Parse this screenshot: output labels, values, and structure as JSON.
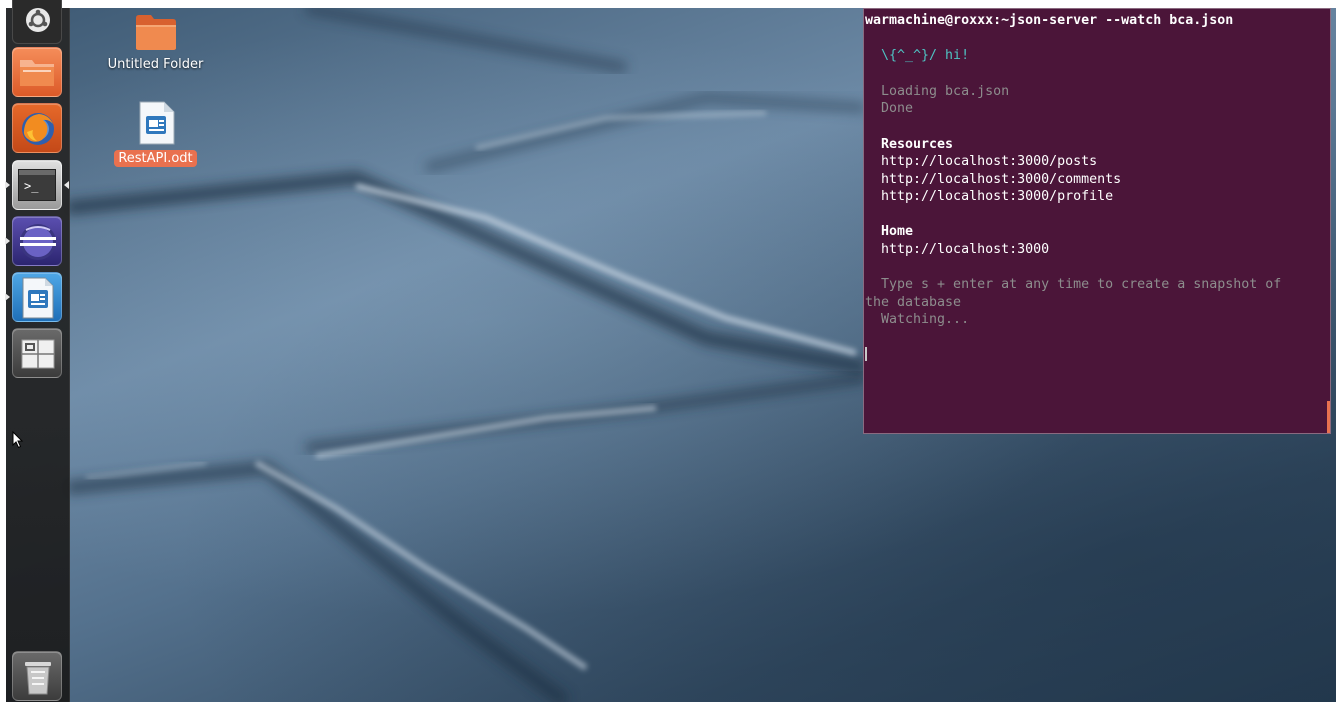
{
  "desktop": {
    "icons": [
      {
        "label": "Untitled Folder",
        "icon": "folder-icon",
        "selected": false
      },
      {
        "label": "RestAPI.odt",
        "icon": "document-icon",
        "selected": true
      }
    ]
  },
  "launcher": {
    "items": [
      {
        "name": "dash-home",
        "icon": "ubuntu-logo-icon"
      },
      {
        "name": "files",
        "icon": "folder-icon"
      },
      {
        "name": "firefox",
        "icon": "firefox-icon"
      },
      {
        "name": "terminal",
        "icon": "terminal-icon",
        "running": true,
        "focused": true
      },
      {
        "name": "eclipse",
        "icon": "eclipse-icon",
        "running": true
      },
      {
        "name": "libreoffice-writer",
        "icon": "writer-icon",
        "running": true
      },
      {
        "name": "workspace-switcher",
        "icon": "workspace-icon"
      },
      {
        "name": "trash",
        "icon": "trash-icon"
      }
    ]
  },
  "terminal": {
    "prompt": "warmachine@roxxx:~json-server --watch bca.json",
    "greeting": "  \\{^_^}/ hi!",
    "loading": "  Loading bca.json",
    "done": "  Done",
    "resources_heading": "  Resources",
    "resources": [
      "  http://localhost:3000/posts",
      "  http://localhost:3000/comments",
      "  http://localhost:3000/profile"
    ],
    "home_heading": "  Home",
    "home_url": "  http://localhost:3000",
    "snapshot_hint_1": "  Type s + enter at any time to create a snapshot of",
    "snapshot_hint_2": "the database",
    "watching": "  Watching..."
  },
  "colors": {
    "terminal_bg": "#4b1539",
    "selection_accent": "#e9714f",
    "greeting_cyan": "#4fc3c3",
    "dim_text": "#8d8d8d"
  }
}
